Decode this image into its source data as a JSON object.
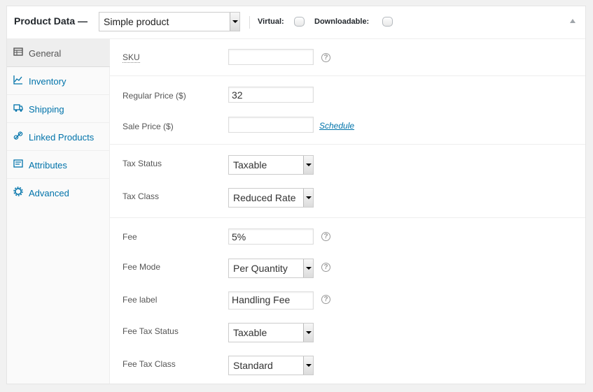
{
  "header": {
    "title": "Product Data —",
    "product_type": "Simple product",
    "virtual_label": "Virtual:",
    "downloadable_label": "Downloadable:"
  },
  "tabs": [
    {
      "label": "General",
      "icon": "table-icon"
    },
    {
      "label": "Inventory",
      "icon": "chart-icon"
    },
    {
      "label": "Shipping",
      "icon": "truck-icon"
    },
    {
      "label": "Linked Products",
      "icon": "link-icon"
    },
    {
      "label": "Attributes",
      "icon": "list-icon"
    },
    {
      "label": "Advanced",
      "icon": "gear-icon"
    }
  ],
  "fields": {
    "sku": {
      "label": "SKU",
      "value": "",
      "help": "?"
    },
    "regular_price": {
      "label": "Regular Price ($)",
      "value": "32"
    },
    "sale_price": {
      "label": "Sale Price ($)",
      "value": "",
      "link": "Schedule"
    },
    "tax_status": {
      "label": "Tax Status",
      "value": "Taxable"
    },
    "tax_class": {
      "label": "Tax Class",
      "value": "Reduced Rate"
    },
    "fee": {
      "label": "Fee",
      "value": "5%",
      "help": "?"
    },
    "fee_mode": {
      "label": "Fee Mode",
      "value": "Per Quantity",
      "help": "?"
    },
    "fee_label": {
      "label": "Fee label",
      "value": "Handling Fee",
      "help": "?"
    },
    "fee_tax_status": {
      "label": "Fee Tax Status",
      "value": "Taxable"
    },
    "fee_tax_class": {
      "label": "Fee Tax Class",
      "value": "Standard"
    }
  },
  "colors": {
    "link": "#0073aa",
    "border": "#dddddd",
    "tab_bg": "#fafafa"
  }
}
